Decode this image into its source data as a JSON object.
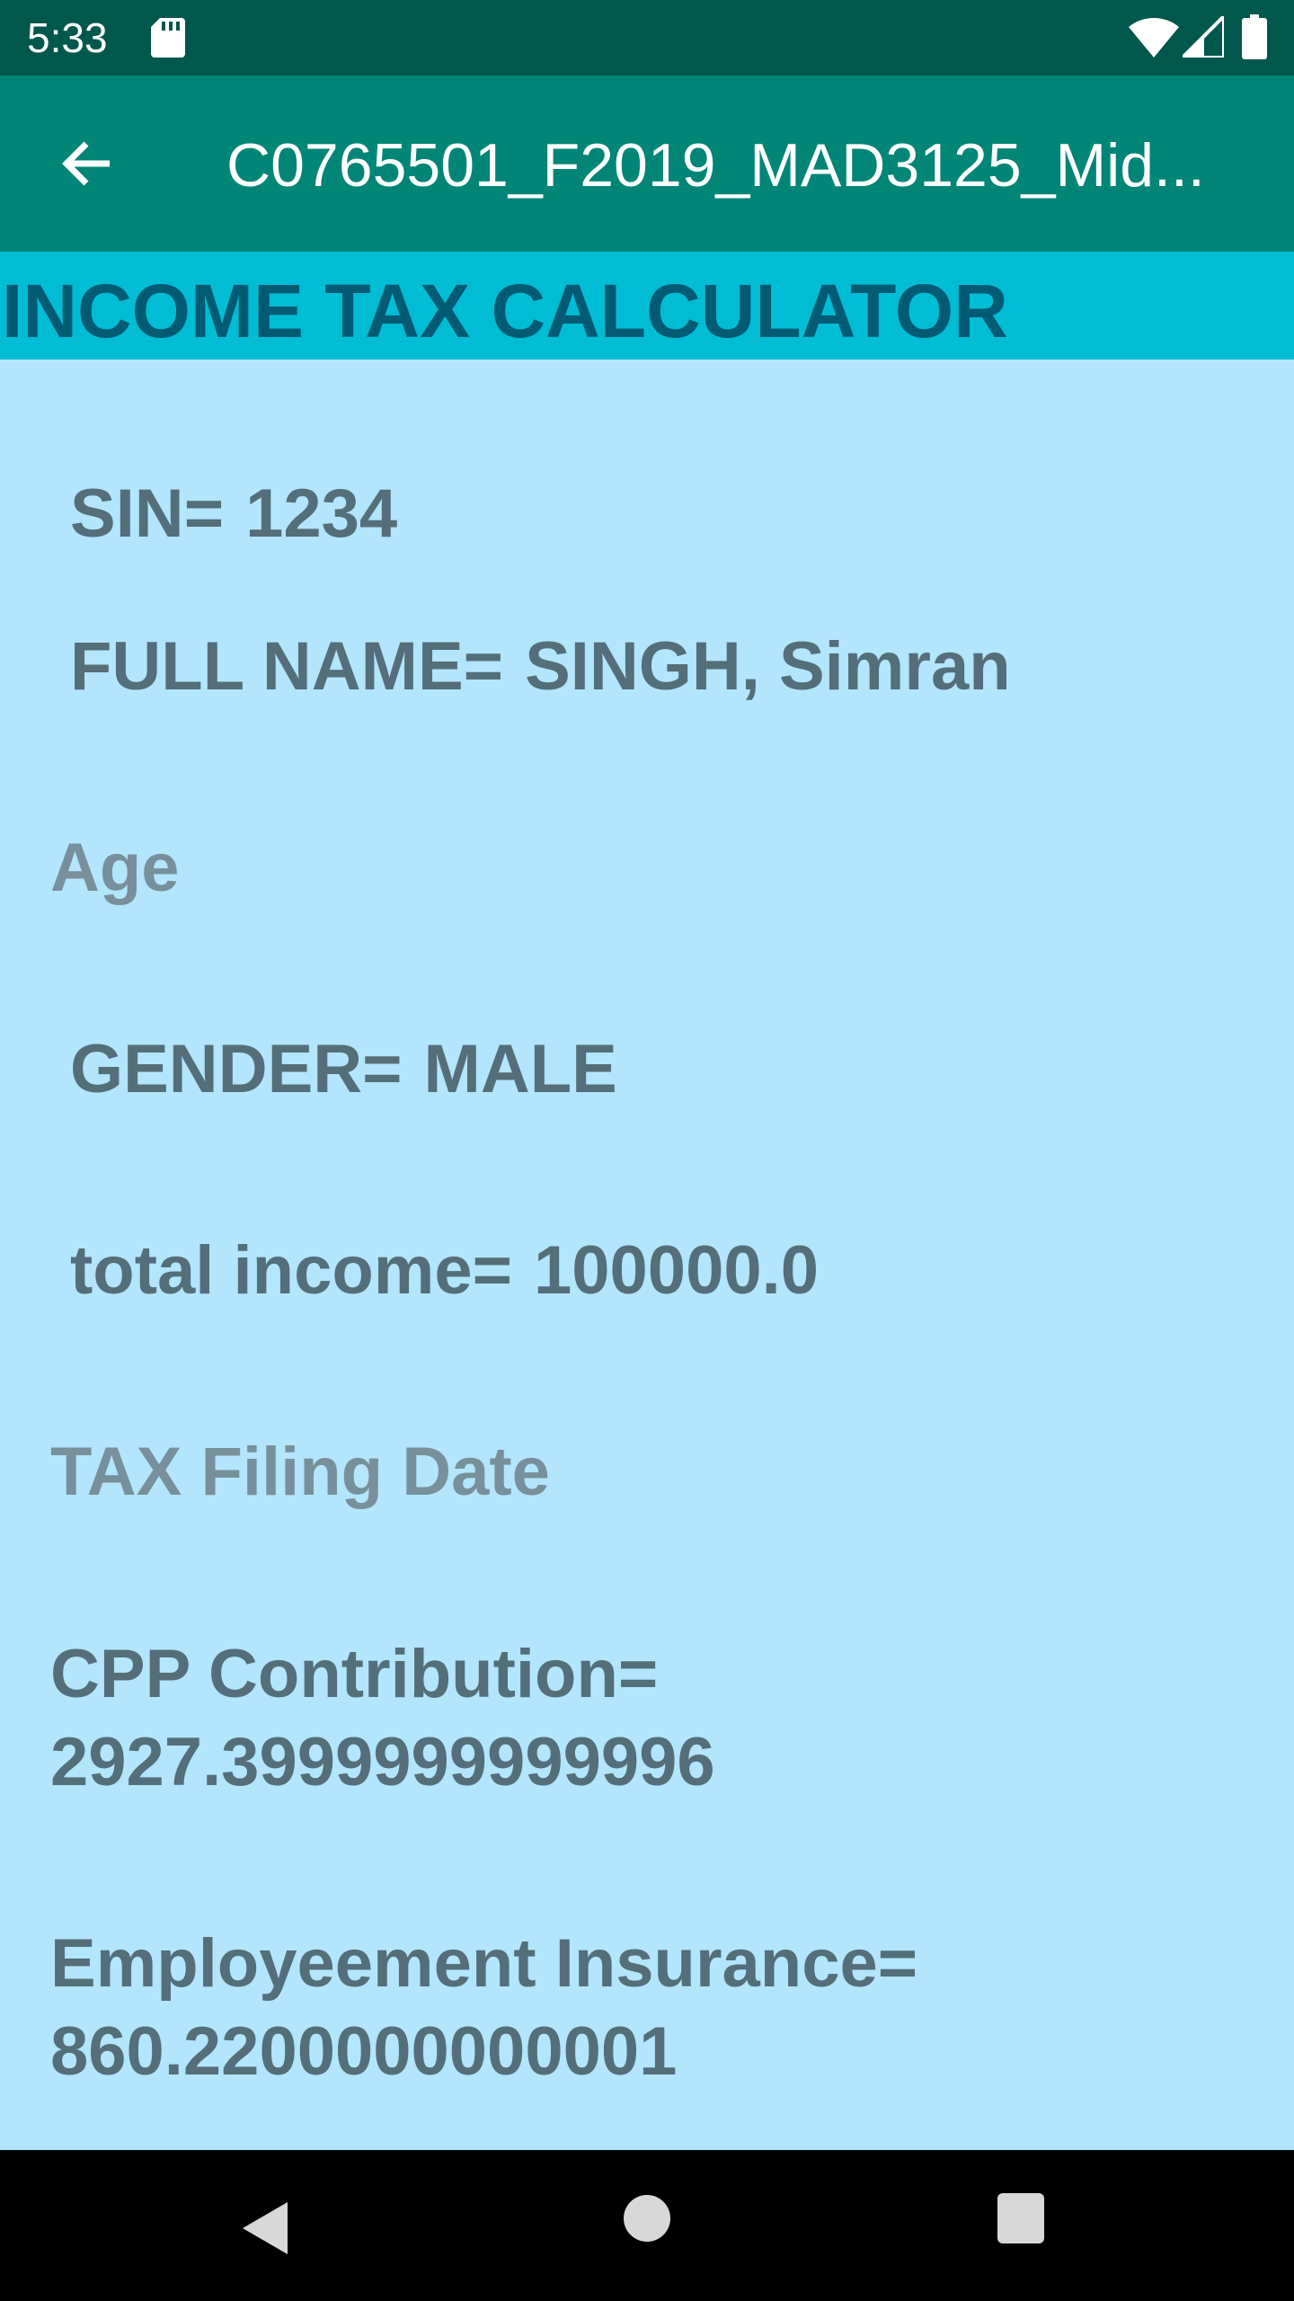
{
  "status_bar": {
    "time": "5:33",
    "icons": [
      "sd-card-icon",
      "wifi-icon",
      "signal-icon",
      "battery-icon"
    ]
  },
  "app_bar": {
    "title": "C0765501_F2019_MAD3125_Mid..."
  },
  "header": {
    "title": "INCOME TAX CALCULATOR"
  },
  "fields": {
    "sin_label": "SIN=",
    "sin_value": "1234",
    "full_name_label": "FULL NAME=",
    "full_name_value": "SINGH, Simran",
    "age_hint": "Age",
    "gender_label": "GENDER=",
    "gender_value": "MALE",
    "income_label": "total income=",
    "income_value": "100000.0",
    "tax_date_hint": "TAX Filing Date",
    "cpp_label": "CPP Contribution=",
    "cpp_value": "2927.3999999999996",
    "ei_label": "Employeement Insurance=",
    "ei_value": "860.2200000000001"
  },
  "colors": {
    "status_bar": "#00574b",
    "app_bar": "#008577",
    "header_banner": "#00bcd4",
    "background": "#b3e5fc",
    "text": "#546e7a"
  }
}
